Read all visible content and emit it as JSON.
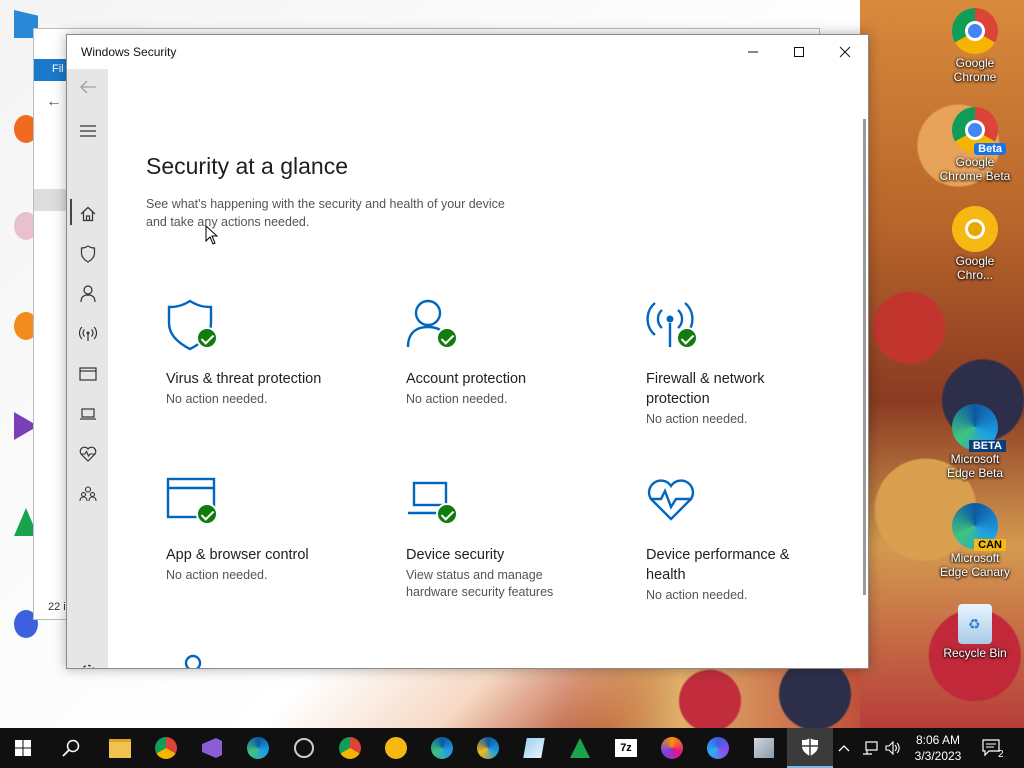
{
  "window": {
    "title": "Windows Security",
    "minimize": "—",
    "maximize": "☐",
    "close": "✕"
  },
  "page": {
    "title": "Security at a glance",
    "subtitle_line1": "See what's happening with the security and health of your device",
    "subtitle_line2": "and take any actions needed."
  },
  "cards": [
    {
      "name": "Virus & threat protection",
      "desc": "No action needed.",
      "icon": "shield-icon"
    },
    {
      "name": "Account protection",
      "desc": "No action needed.",
      "icon": "person-icon"
    },
    {
      "name_line1": "Firewall & network",
      "name_line2": "protection",
      "desc": "No action needed.",
      "icon": "wifi-signal-icon"
    },
    {
      "name": "App & browser control",
      "desc": "No action needed.",
      "icon": "browser-window-icon"
    },
    {
      "name": "Device security",
      "desc_line1": "View status and manage",
      "desc_line2": "hardware security features",
      "icon": "laptop-icon"
    },
    {
      "name_line1": "Device performance &",
      "name_line2": "health",
      "desc": "No action needed.",
      "icon": "heart-pulse-icon"
    },
    {
      "icon": "family-icon"
    }
  ],
  "nav": [
    "back-arrow-icon",
    "hamburger-menu-icon",
    "home-icon",
    "shield-icon",
    "person-icon",
    "wifi-signal-icon",
    "browser-window-icon",
    "laptop-icon",
    "heart-pulse-icon",
    "family-icon",
    "gear-icon"
  ],
  "background_window": {
    "ribbon": "Fil",
    "count": "22 i"
  },
  "desktop_icons": [
    {
      "label_line1": "Google",
      "label_line2": "Chrome"
    },
    {
      "label_line1": "Google",
      "label_line2": "Chrome Beta",
      "badge": "Beta"
    },
    {
      "label_line1": "Google",
      "label_line2": "Chro..."
    },
    {
      "label_line1": "Microsoft",
      "label_line2": "Edge Beta",
      "badge": "BETA"
    },
    {
      "label_line1": "Microsoft",
      "label_line2": "Edge Canary",
      "badge": "CAN"
    },
    {
      "label_line1": "Recycle Bin",
      "label_line2": ""
    }
  ],
  "taskbar": {
    "time": "8:06 AM",
    "date": "3/3/2023",
    "notifications": "2",
    "seven_zip": "7z"
  },
  "colors": {
    "accent_blue": "#0067c0",
    "check_green": "#107c10",
    "nav_bg": "#e6e6e6"
  }
}
